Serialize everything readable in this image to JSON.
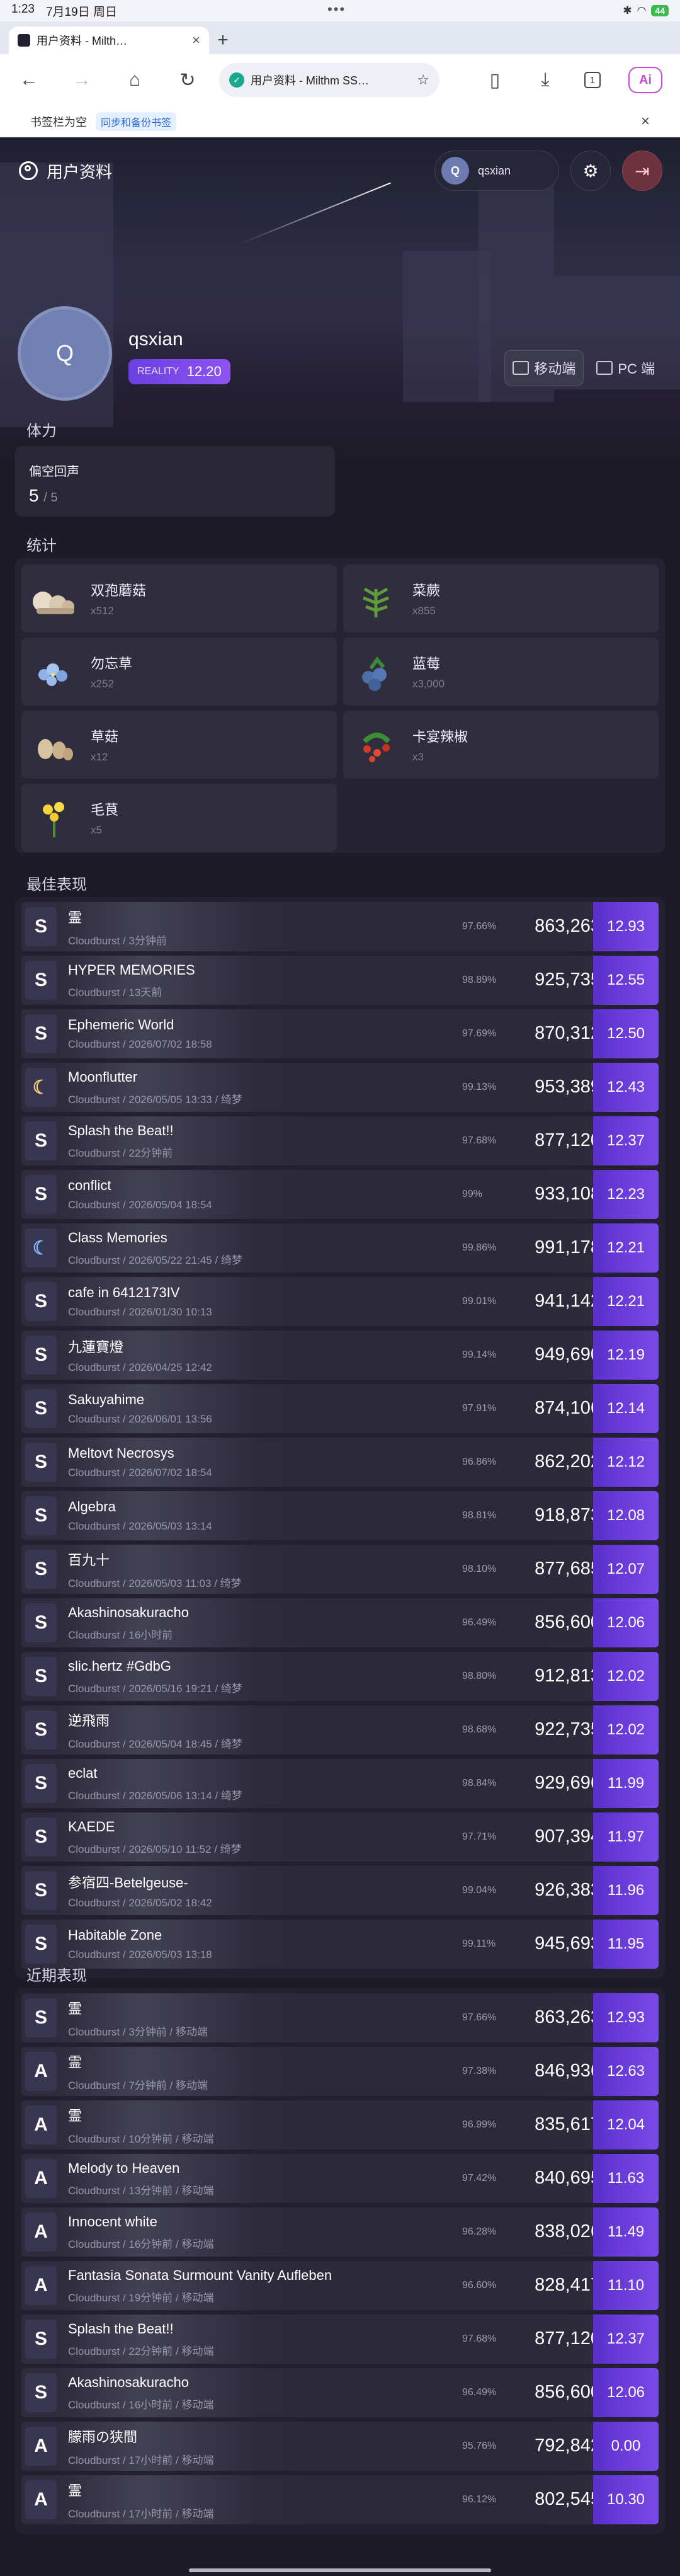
{
  "status": {
    "time": "1:23",
    "date": "7月19日 周日",
    "battery": "44",
    "dots": "•••"
  },
  "tab": {
    "title": "用户资料 - Milth…"
  },
  "url": {
    "text": "用户资料 - Milthm SS…"
  },
  "toolbar": {
    "tab_count": "1",
    "ai": "Ai"
  },
  "bookmarks": {
    "empty": "书签栏为空",
    "sync": "同步和备份书签"
  },
  "page": {
    "title": "用户资料",
    "user": "qsxian",
    "avatar_initial": "Q"
  },
  "profile": {
    "reality_label": "REALITY",
    "reality_value": "12.20"
  },
  "platforms": {
    "mobile": "移动端",
    "pc": "PC 端"
  },
  "stamina": {
    "heading": "体力",
    "name": "偏空回声",
    "value": "5",
    "max": "/ 5"
  },
  "stats": {
    "heading": "统计",
    "items": [
      {
        "name": "双孢蘑菇",
        "count": "x512",
        "pic": "mushroom"
      },
      {
        "name": "菜蕨",
        "count": "x855",
        "pic": "fern"
      },
      {
        "name": "勿忘草",
        "count": "x252",
        "pic": "forgetmenot"
      },
      {
        "name": "蓝莓",
        "count": "x3,000",
        "pic": "blueberry"
      },
      {
        "name": "草菇",
        "count": "x12",
        "pic": "strawmushroom"
      },
      {
        "name": "卡宴辣椒",
        "count": "x3",
        "pic": "pepper"
      },
      {
        "name": "毛茛",
        "count": "x5",
        "pic": "buttercup"
      }
    ]
  },
  "best": {
    "heading": "最佳表现",
    "rows": [
      {
        "icon": "S",
        "song": "霊",
        "sub": "Cloudburst / 3分钟前",
        "acc": "97.66%",
        "score": "863,263",
        "rating": "12.93"
      },
      {
        "icon": "S",
        "song": "HYPER MEMORIES",
        "sub": "Cloudburst / 13天前",
        "acc": "98.89%",
        "score": "925,735",
        "rating": "12.55"
      },
      {
        "icon": "S",
        "song": "Ephemeric World",
        "sub": "Cloudburst / 2026/07/02 18:58",
        "acc": "97.69%",
        "score": "870,312",
        "rating": "12.50"
      },
      {
        "icon": "moon",
        "song": "Moonflutter",
        "sub": "Cloudburst / 2026/05/05 13:33 / 绮梦",
        "acc": "99.13%",
        "score": "953,389",
        "rating": "12.43"
      },
      {
        "icon": "S",
        "song": "Splash the Beat!!",
        "sub": "Cloudburst / 22分钟前",
        "acc": "97.68%",
        "score": "877,120",
        "rating": "12.37"
      },
      {
        "icon": "S",
        "song": "conflict",
        "sub": "Cloudburst / 2026/05/04 18:54",
        "acc": "99%",
        "score": "933,108",
        "rating": "12.23"
      },
      {
        "icon": "moonb",
        "song": "Class Memories",
        "sub": "Cloudburst / 2026/05/22 21:45 / 绮梦",
        "acc": "99.86%",
        "score": "991,178",
        "rating": "12.21"
      },
      {
        "icon": "S",
        "song": "cafe in 6412173IV",
        "sub": "Cloudburst / 2026/01/30 10:13",
        "acc": "99.01%",
        "score": "941,142",
        "rating": "12.21"
      },
      {
        "icon": "S",
        "song": "九蓮寶燈",
        "sub": "Cloudburst / 2026/04/25 12:42",
        "acc": "99.14%",
        "score": "949,690",
        "rating": "12.19"
      },
      {
        "icon": "S",
        "song": "Sakuyahime",
        "sub": "Cloudburst / 2026/06/01 13:56",
        "acc": "97.91%",
        "score": "874,106",
        "rating": "12.14"
      },
      {
        "icon": "S",
        "song": "Meltovt Necrosys",
        "sub": "Cloudburst / 2026/07/02 18:54",
        "acc": "96.86%",
        "score": "862,202",
        "rating": "12.12"
      },
      {
        "icon": "S",
        "song": "Algebra",
        "sub": "Cloudburst / 2026/05/03 13:14",
        "acc": "98.81%",
        "score": "918,873",
        "rating": "12.08"
      },
      {
        "icon": "S",
        "song": "百九十",
        "sub": "Cloudburst / 2026/05/03 11:03 / 绮梦",
        "acc": "98.10%",
        "score": "877,685",
        "rating": "12.07"
      },
      {
        "icon": "S",
        "song": "Akashinosakuracho",
        "sub": "Cloudburst / 16小时前",
        "acc": "96.49%",
        "score": "856,600",
        "rating": "12.06"
      },
      {
        "icon": "S",
        "song": "slic.hertz #GdbG",
        "sub": "Cloudburst / 2026/05/16 19:21 / 绮梦",
        "acc": "98.80%",
        "score": "912,813",
        "rating": "12.02"
      },
      {
        "icon": "S",
        "song": "逆飛雨",
        "sub": "Cloudburst / 2026/05/04 18:45 / 绮梦",
        "acc": "98.68%",
        "score": "922,735",
        "rating": "12.02"
      },
      {
        "icon": "S",
        "song": "eclat",
        "sub": "Cloudburst / 2026/05/06 13:14 / 绮梦",
        "acc": "98.84%",
        "score": "929,696",
        "rating": "11.99"
      },
      {
        "icon": "S",
        "song": "KAEDE",
        "sub": "Cloudburst / 2026/05/10 11:52 / 绮梦",
        "acc": "97.71%",
        "score": "907,394",
        "rating": "11.97"
      },
      {
        "icon": "S",
        "song": "参宿四-Betelgeuse-",
        "sub": "Cloudburst / 2026/05/02 18:42",
        "acc": "99.04%",
        "score": "926,383",
        "rating": "11.96"
      },
      {
        "icon": "S",
        "song": "Habitable Zone",
        "sub": "Cloudburst / 2026/05/03 13:18",
        "acc": "99.11%",
        "score": "945,693",
        "rating": "11.95"
      }
    ]
  },
  "recent": {
    "heading": "近期表现",
    "rows": [
      {
        "icon": "S",
        "song": "霊",
        "sub": "Cloudburst / 3分钟前 / 移动端",
        "acc": "97.66%",
        "score": "863,263",
        "rating": "12.93"
      },
      {
        "icon": "A",
        "song": "霊",
        "sub": "Cloudburst / 7分钟前 / 移动端",
        "acc": "97.38%",
        "score": "846,936",
        "rating": "12.63"
      },
      {
        "icon": "A",
        "song": "霊",
        "sub": "Cloudburst / 10分钟前 / 移动端",
        "acc": "96.99%",
        "score": "835,617",
        "rating": "12.04"
      },
      {
        "icon": "A",
        "song": "Melody to Heaven",
        "sub": "Cloudburst / 13分钟前 / 移动端",
        "acc": "97.42%",
        "score": "840,695",
        "rating": "11.63"
      },
      {
        "icon": "A",
        "song": "Innocent white",
        "sub": "Cloudburst / 16分钟前 / 移动端",
        "acc": "96.28%",
        "score": "838,026",
        "rating": "11.49"
      },
      {
        "icon": "A",
        "song": "Fantasia Sonata Surmount Vanity Aufleben",
        "sub": "Cloudburst / 19分钟前 / 移动端",
        "acc": "96.60%",
        "score": "828,417",
        "rating": "11.10"
      },
      {
        "icon": "S",
        "song": "Splash the Beat!!",
        "sub": "Cloudburst / 22分钟前 / 移动端",
        "acc": "97.68%",
        "score": "877,120",
        "rating": "12.37"
      },
      {
        "icon": "S",
        "song": "Akashinosakuracho",
        "sub": "Cloudburst / 16小时前 / 移动端",
        "acc": "96.49%",
        "score": "856,600",
        "rating": "12.06"
      },
      {
        "icon": "A",
        "song": "朦雨の狭間",
        "sub": "Cloudburst / 17小时前 / 移动端",
        "acc": "95.76%",
        "score": "792,842",
        "rating": "0.00"
      },
      {
        "icon": "A",
        "song": "霊",
        "sub": "Cloudburst / 17小时前 / 移动端",
        "acc": "96.12%",
        "score": "802,545",
        "rating": "10.30"
      }
    ]
  },
  "colors": {
    "accent": "#7c4ae8",
    "background": "#1d1b27",
    "card": "#2f2d3e",
    "exit": "#6d3140"
  }
}
